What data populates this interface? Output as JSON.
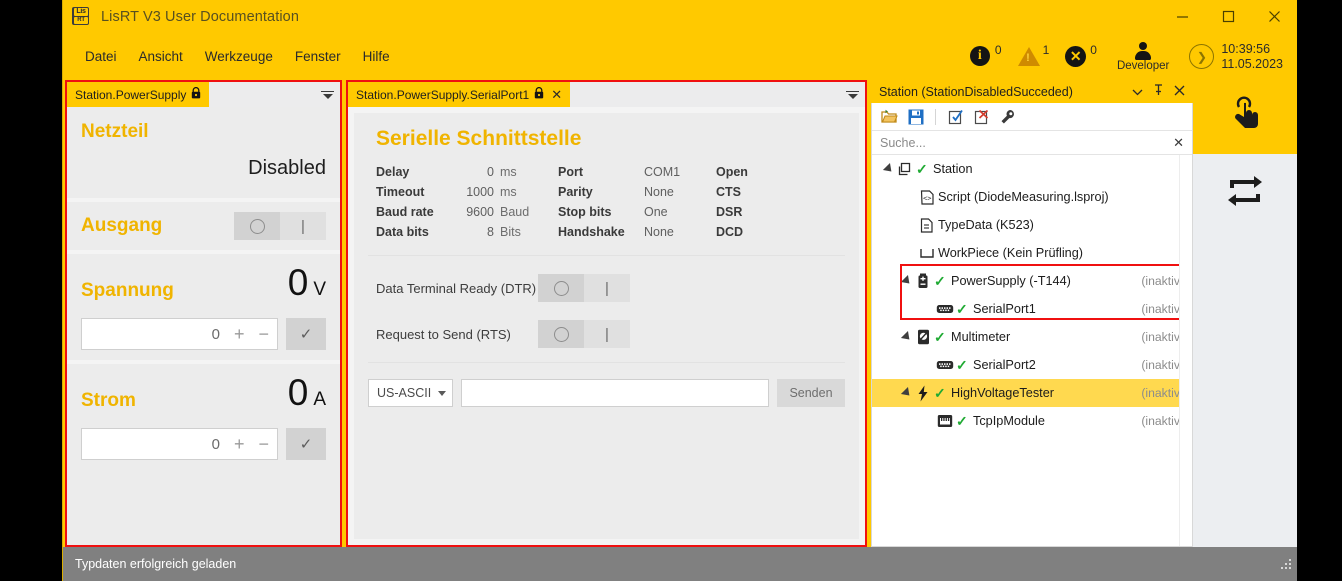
{
  "window": {
    "title": "LisRT V3 User Documentation",
    "logo_top": "Lis",
    "logo_bottom": "RT",
    "minimize": "—",
    "maximize": "□",
    "close": "✕"
  },
  "menubar": {
    "items": [
      "Datei",
      "Ansicht",
      "Werkzeuge",
      "Fenster",
      "Hilfe"
    ]
  },
  "status_cluster": {
    "info_count": "0",
    "warning_count": "1",
    "error_count": "0",
    "user": "Developer",
    "time": "10:39:56",
    "date": "11.05.2023"
  },
  "power_supply_panel": {
    "tab_label": "Station.PowerSupply",
    "lock_glyph": "🔒",
    "title": "Netzteil",
    "state": "Disabled",
    "output": {
      "label": "Ausgang",
      "off_glyph": "○",
      "on_glyph": "|"
    },
    "voltage": {
      "label": "Spannung",
      "value": "0",
      "unit": "V",
      "setpoint": "0",
      "plus": "+",
      "minus": "−",
      "confirm": "✓"
    },
    "current": {
      "label": "Strom",
      "value": "0",
      "unit": "A",
      "setpoint": "0",
      "plus": "+",
      "minus": "−",
      "confirm": "✓"
    }
  },
  "serial_panel": {
    "tab_label": "Station.PowerSupply.SerialPort1",
    "lock_glyph": "🔒",
    "close_glyph": "✕",
    "title": "Serielle Schnittstelle",
    "params": [
      {
        "label": "Delay",
        "value": "0",
        "unit": "ms"
      },
      {
        "label": "Timeout",
        "value": "1000",
        "unit": "ms"
      },
      {
        "label": "Baud rate",
        "value": "9600",
        "unit": "Baud"
      },
      {
        "label": "Data bits",
        "value": "8",
        "unit": "Bits"
      }
    ],
    "settings": [
      {
        "label": "Port",
        "value": "COM1"
      },
      {
        "label": "Parity",
        "value": "None"
      },
      {
        "label": "Stop bits",
        "value": "One"
      },
      {
        "label": "Handshake",
        "value": "None"
      }
    ],
    "signals": [
      {
        "label": "Open",
        "on": false
      },
      {
        "label": "CTS",
        "on": false
      },
      {
        "label": "DSR",
        "on": false
      },
      {
        "label": "DCD",
        "on": false
      }
    ],
    "controls": [
      {
        "label": "Data Terminal Ready (DTR)",
        "off_glyph": "○",
        "on_glyph": "|"
      },
      {
        "label": "Request to Send (RTS)",
        "off_glyph": "○",
        "on_glyph": "|"
      }
    ],
    "send": {
      "encoding": "US-ASCII",
      "input_value": "",
      "input_placeholder": "",
      "button": "Senden"
    }
  },
  "station_panel": {
    "title": "Station (StationDisabledSucceded)",
    "header_actions": [
      "▾",
      "📌",
      "✕"
    ],
    "toolbar": [
      {
        "name": "open-icon"
      },
      {
        "name": "save-icon"
      },
      {
        "name": "check-out-icon"
      },
      {
        "name": "check-in-icon"
      },
      {
        "name": "wrench-icon"
      }
    ],
    "search": {
      "placeholder": "Suche...",
      "value": "",
      "clear_glyph": "✕"
    },
    "tree": [
      {
        "label": "Station",
        "state": "",
        "icon": "station-icon",
        "depth": 0,
        "arrow": true,
        "check": "✓",
        "selected": false
      },
      {
        "label": "Script (DiodeMeasuring.lsproj)",
        "state": "",
        "icon": "script-icon",
        "depth": 1,
        "arrow": false,
        "check": "",
        "selected": false
      },
      {
        "label": "TypeData (K523)",
        "state": "",
        "icon": "document-icon",
        "depth": 1,
        "arrow": false,
        "check": "",
        "selected": false
      },
      {
        "label": "WorkPiece (Kein Prüfling)",
        "state": "",
        "icon": "workpiece-icon",
        "depth": 1,
        "arrow": false,
        "check": "",
        "selected": false
      },
      {
        "label": "PowerSupply (-T144)",
        "state": "(inaktiv)",
        "icon": "battery-icon",
        "depth": 1,
        "arrow": true,
        "check": "✓",
        "selected": false
      },
      {
        "label": "SerialPort1",
        "state": "(inaktiv)",
        "icon": "serialport-icon",
        "depth": 2,
        "arrow": false,
        "check": "✓",
        "selected": false
      },
      {
        "label": "Multimeter",
        "state": "(inaktiv)",
        "icon": "multimeter-icon",
        "depth": 1,
        "arrow": true,
        "check": "✓",
        "selected": false
      },
      {
        "label": "SerialPort2",
        "state": "(inaktiv)",
        "icon": "serialport-icon",
        "depth": 2,
        "arrow": false,
        "check": "✓",
        "selected": false
      },
      {
        "label": "HighVoltageTester",
        "state": "(inaktiv)",
        "icon": "bolt-icon",
        "depth": 1,
        "arrow": true,
        "check": "✓",
        "selected": true
      },
      {
        "label": "TcpIpModule",
        "state": "(inaktiv)",
        "icon": "network-icon",
        "depth": 2,
        "arrow": false,
        "check": "✓",
        "selected": false
      }
    ]
  },
  "rail": {
    "buttons": [
      {
        "name": "touch-interaction-icon",
        "active": true
      },
      {
        "name": "swap-arrows-icon",
        "active": false
      }
    ]
  },
  "statusbar": {
    "message": "Typdaten erfolgreich geladen"
  },
  "colors": {
    "brand_yellow": "#ffc900",
    "accent_label": "#f0b400",
    "highlight_red": "#f01010",
    "selection_yellow": "#ffd94f",
    "check_green": "#1faa33"
  }
}
